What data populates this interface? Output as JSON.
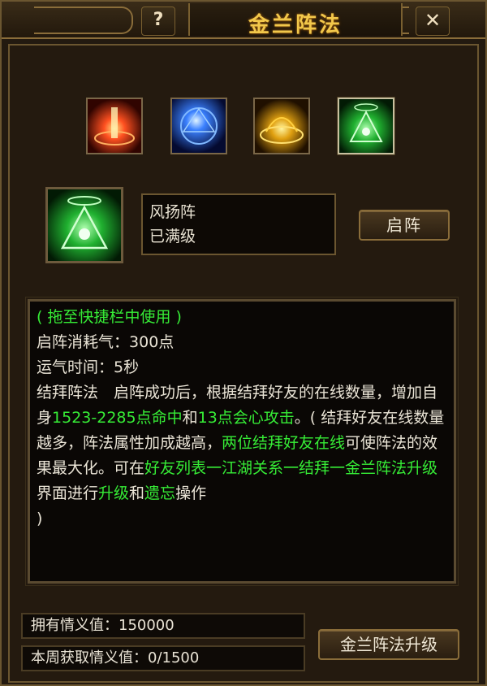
{
  "window": {
    "title": "金兰阵法",
    "help_label": "?",
    "close_label": "✕"
  },
  "skills": [
    {
      "icon": "fire-formation-icon",
      "color": "#e83a1a"
    },
    {
      "icon": "blue-formation-icon",
      "color": "#2a6cf0"
    },
    {
      "icon": "gold-formation-icon",
      "color": "#e8b020"
    },
    {
      "icon": "wind-formation-icon",
      "color": "#30e040",
      "selected": true
    }
  ],
  "selected": {
    "name": "风扬阵",
    "status": "已满级",
    "activate_label": "启阵"
  },
  "description": {
    "line1": "( 拖至快捷栏中使用 )",
    "cost_label": "启阵消耗气：",
    "cost_value": "300点",
    "time_label": "运气时间：",
    "time_value": "5秒",
    "p1": "结拜阵法　启阵成功后，根据结拜好友的在线数量，增加自身",
    "hit": "1523-2285点命中",
    "and1": "和",
    "crit": "13点会心攻击",
    "p2": "。( 结拜好友在线数量越多，阵法属性加成越高，",
    "two_online": "两位结拜好友在线",
    "p3": "可使阵法的效果最大化。可在",
    "path": "好友列表一江湖关系一结拜一金兰阵法升级",
    "p4": "界面进行",
    "upgrade_word": "升级",
    "and2": "和",
    "forget_word": "遗忘",
    "p5": "操作",
    "close_paren": ")"
  },
  "stats": {
    "owned_label": "拥有情义值：",
    "owned_value": "150000",
    "weekly_label": "本周获取情义值：",
    "weekly_value": "0/1500"
  },
  "upgrade_button": "金兰阵法升级"
}
